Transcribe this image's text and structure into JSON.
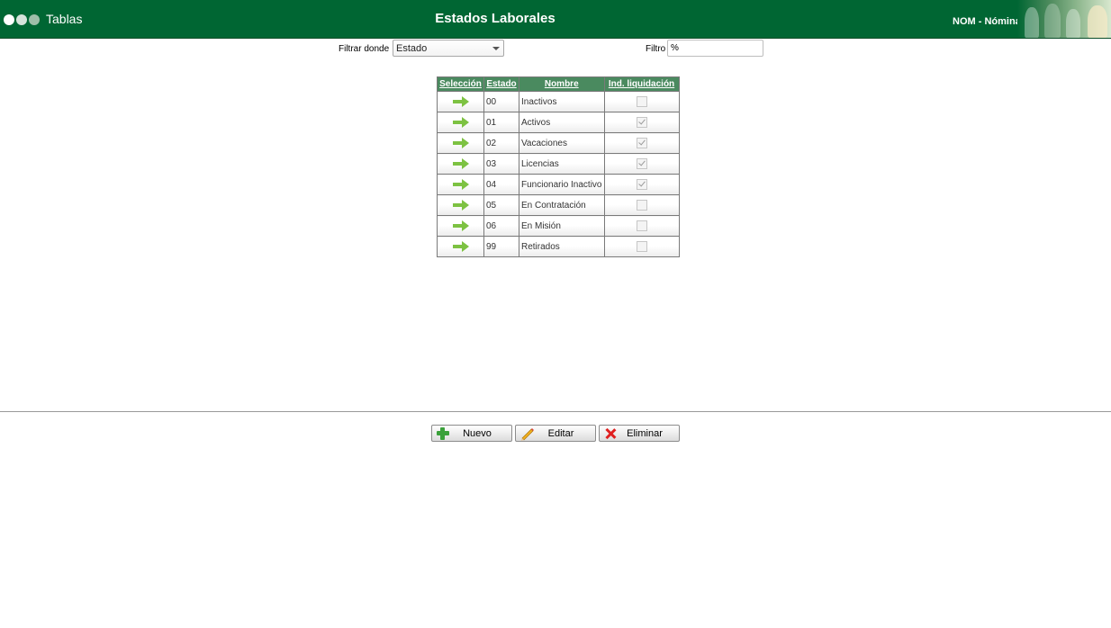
{
  "header": {
    "app_name": "Tablas",
    "title": "Estados Laborales",
    "module": "NOM - Nómina"
  },
  "filter": {
    "label": "Filtrar donde",
    "field": "Estado",
    "filtro_label": "Filtro",
    "filtro_value": "%"
  },
  "table": {
    "columns": [
      "Selección",
      "Estado",
      "Nombre",
      "Ind. liquidación"
    ],
    "rows": [
      {
        "estado": "00",
        "nombre": "Inactivos",
        "ind": false
      },
      {
        "estado": "01",
        "nombre": "Activos",
        "ind": true
      },
      {
        "estado": "02",
        "nombre": "Vacaciones",
        "ind": true
      },
      {
        "estado": "03",
        "nombre": "Licencias",
        "ind": true
      },
      {
        "estado": "04",
        "nombre": "Funcionario Inactivo",
        "ind": true
      },
      {
        "estado": "05",
        "nombre": "En Contratación",
        "ind": false
      },
      {
        "estado": "06",
        "nombre": "En Misión",
        "ind": false
      },
      {
        "estado": "99",
        "nombre": "Retirados",
        "ind": false
      }
    ]
  },
  "buttons": {
    "nuevo": "Nuevo",
    "editar": "Editar",
    "eliminar": "Eliminar"
  },
  "colors": {
    "header_green": "#006633",
    "table_header": "#4a8a5f",
    "arrow_green": "#7dc242"
  }
}
